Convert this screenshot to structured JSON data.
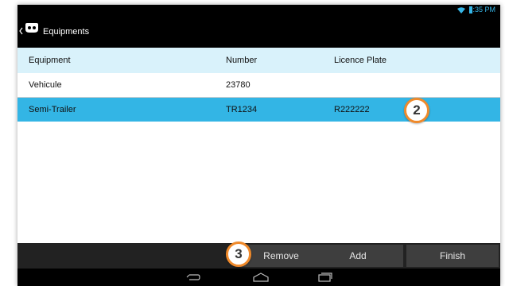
{
  "status": {
    "time": "2:35 PM"
  },
  "app": {
    "title": "Equipments"
  },
  "table": {
    "headers": [
      "Equipment",
      "Number",
      "Licence Plate"
    ],
    "rows": [
      {
        "equipment": "Vehicule",
        "number": "23780",
        "plate": ""
      },
      {
        "equipment": "Semi-Trailer",
        "number": "TR1234",
        "plate": "R222222"
      }
    ],
    "selected_row": 1
  },
  "buttons": {
    "remove": "Remove",
    "add": "Add",
    "finish": "Finish"
  },
  "callouts": {
    "c2": "2",
    "c3": "3"
  },
  "colors": {
    "accent": "#33b5e5",
    "header_bg": "#d9f2fb",
    "callout_border": "#f08a2b"
  }
}
